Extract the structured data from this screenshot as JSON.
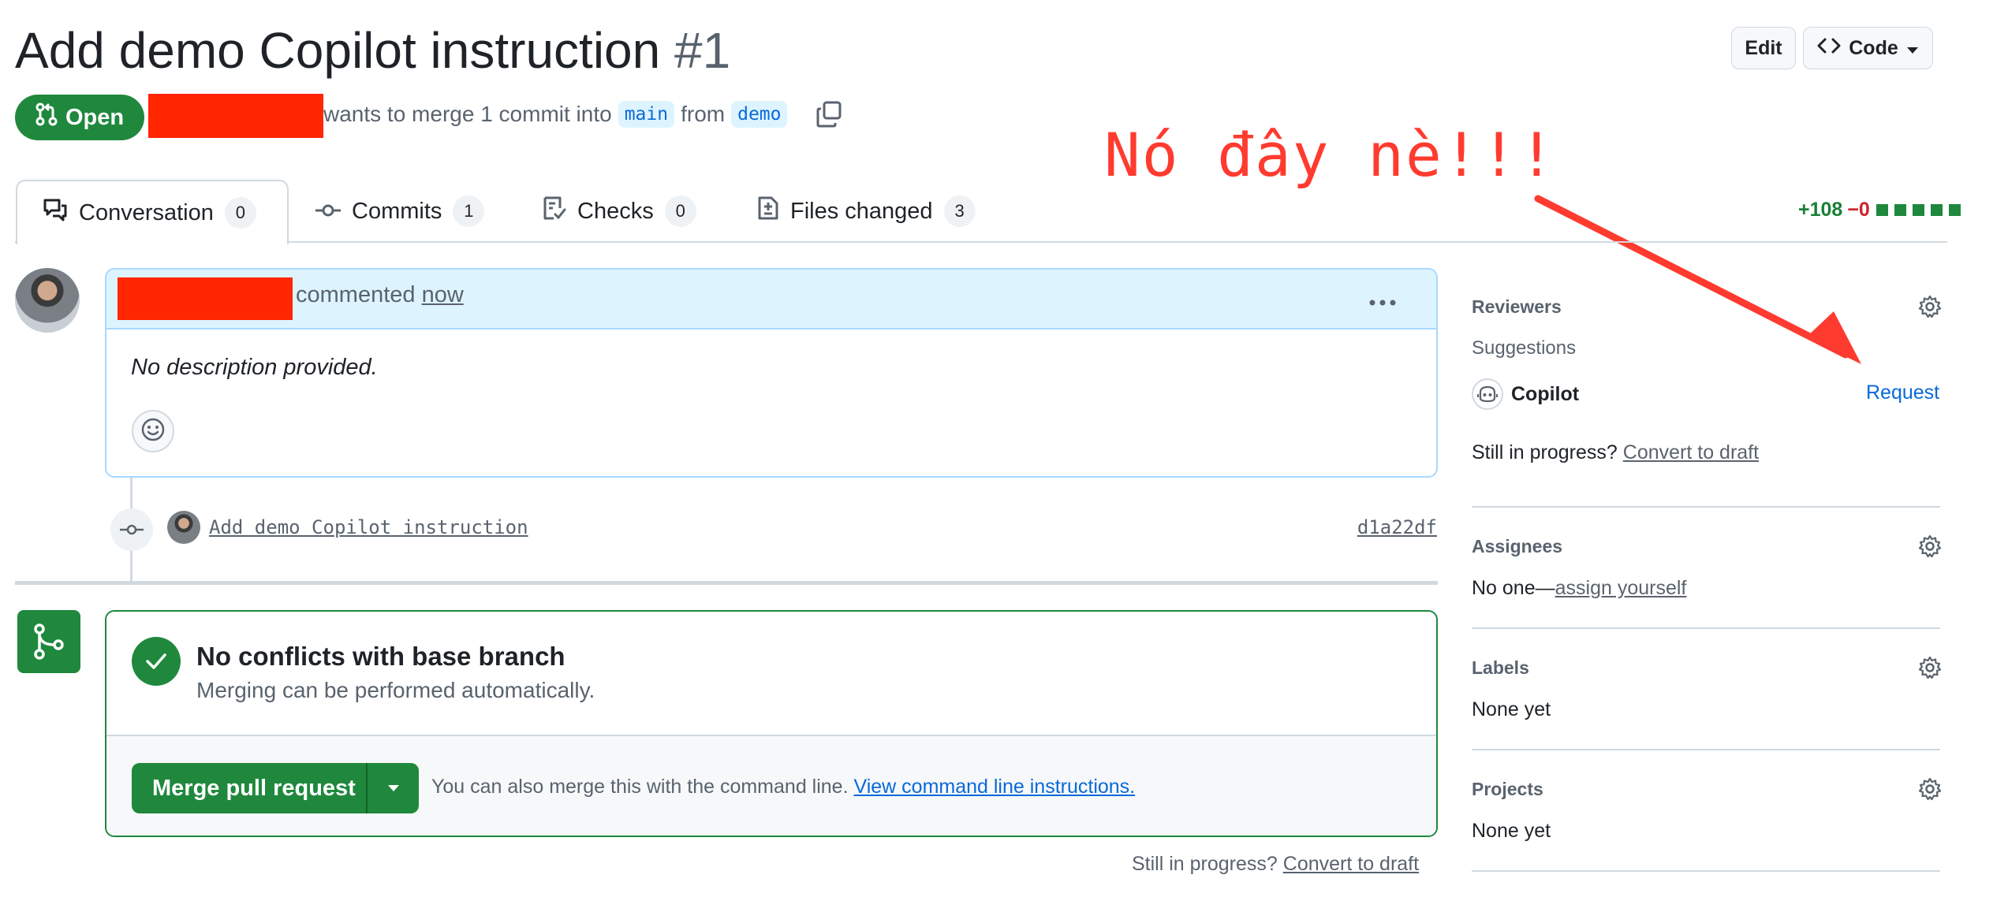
{
  "pr": {
    "title": "Add demo Copilot instruction",
    "number": "#1",
    "state": "Open",
    "merge_text": "wants to merge 1 commit into",
    "base_branch": "main",
    "from_text": "from",
    "head_branch": "demo"
  },
  "header": {
    "edit_label": "Edit",
    "code_label": "Code"
  },
  "annotation": "Nó đây nè!!!",
  "tabs": [
    {
      "label": "Conversation",
      "count": "0"
    },
    {
      "label": "Commits",
      "count": "1"
    },
    {
      "label": "Checks",
      "count": "0"
    },
    {
      "label": "Files changed",
      "count": "3"
    }
  ],
  "diffstat": {
    "additions": "+108",
    "deletions": "−0"
  },
  "comment": {
    "action": "commented",
    "time": "now",
    "body": "No description provided."
  },
  "commit": {
    "message": "Add demo Copilot instruction",
    "sha": "d1a22df"
  },
  "merge": {
    "status_title": "No conflicts with base branch",
    "status_sub": "Merging can be performed automatically.",
    "button_label": "Merge pull request",
    "hint": "You can also merge this with the command line.",
    "hint_link": "View command line instructions."
  },
  "draft_prompt": {
    "text": "Still in progress?",
    "link": "Convert to draft"
  },
  "sidebar": {
    "reviewers": {
      "heading": "Reviewers",
      "suggestions": "Suggestions",
      "suggested": "Copilot",
      "request": "Request"
    },
    "assignees": {
      "heading": "Assignees",
      "prefix": "No one—",
      "link": "assign yourself"
    },
    "labels": {
      "heading": "Labels",
      "value": "None yet"
    },
    "projects": {
      "heading": "Projects",
      "value": "None yet"
    }
  },
  "colors": {
    "open_green": "#1f883d",
    "link_blue": "#0969da",
    "annotation_red": "#ff3b2f",
    "redaction": "#ff2600"
  }
}
